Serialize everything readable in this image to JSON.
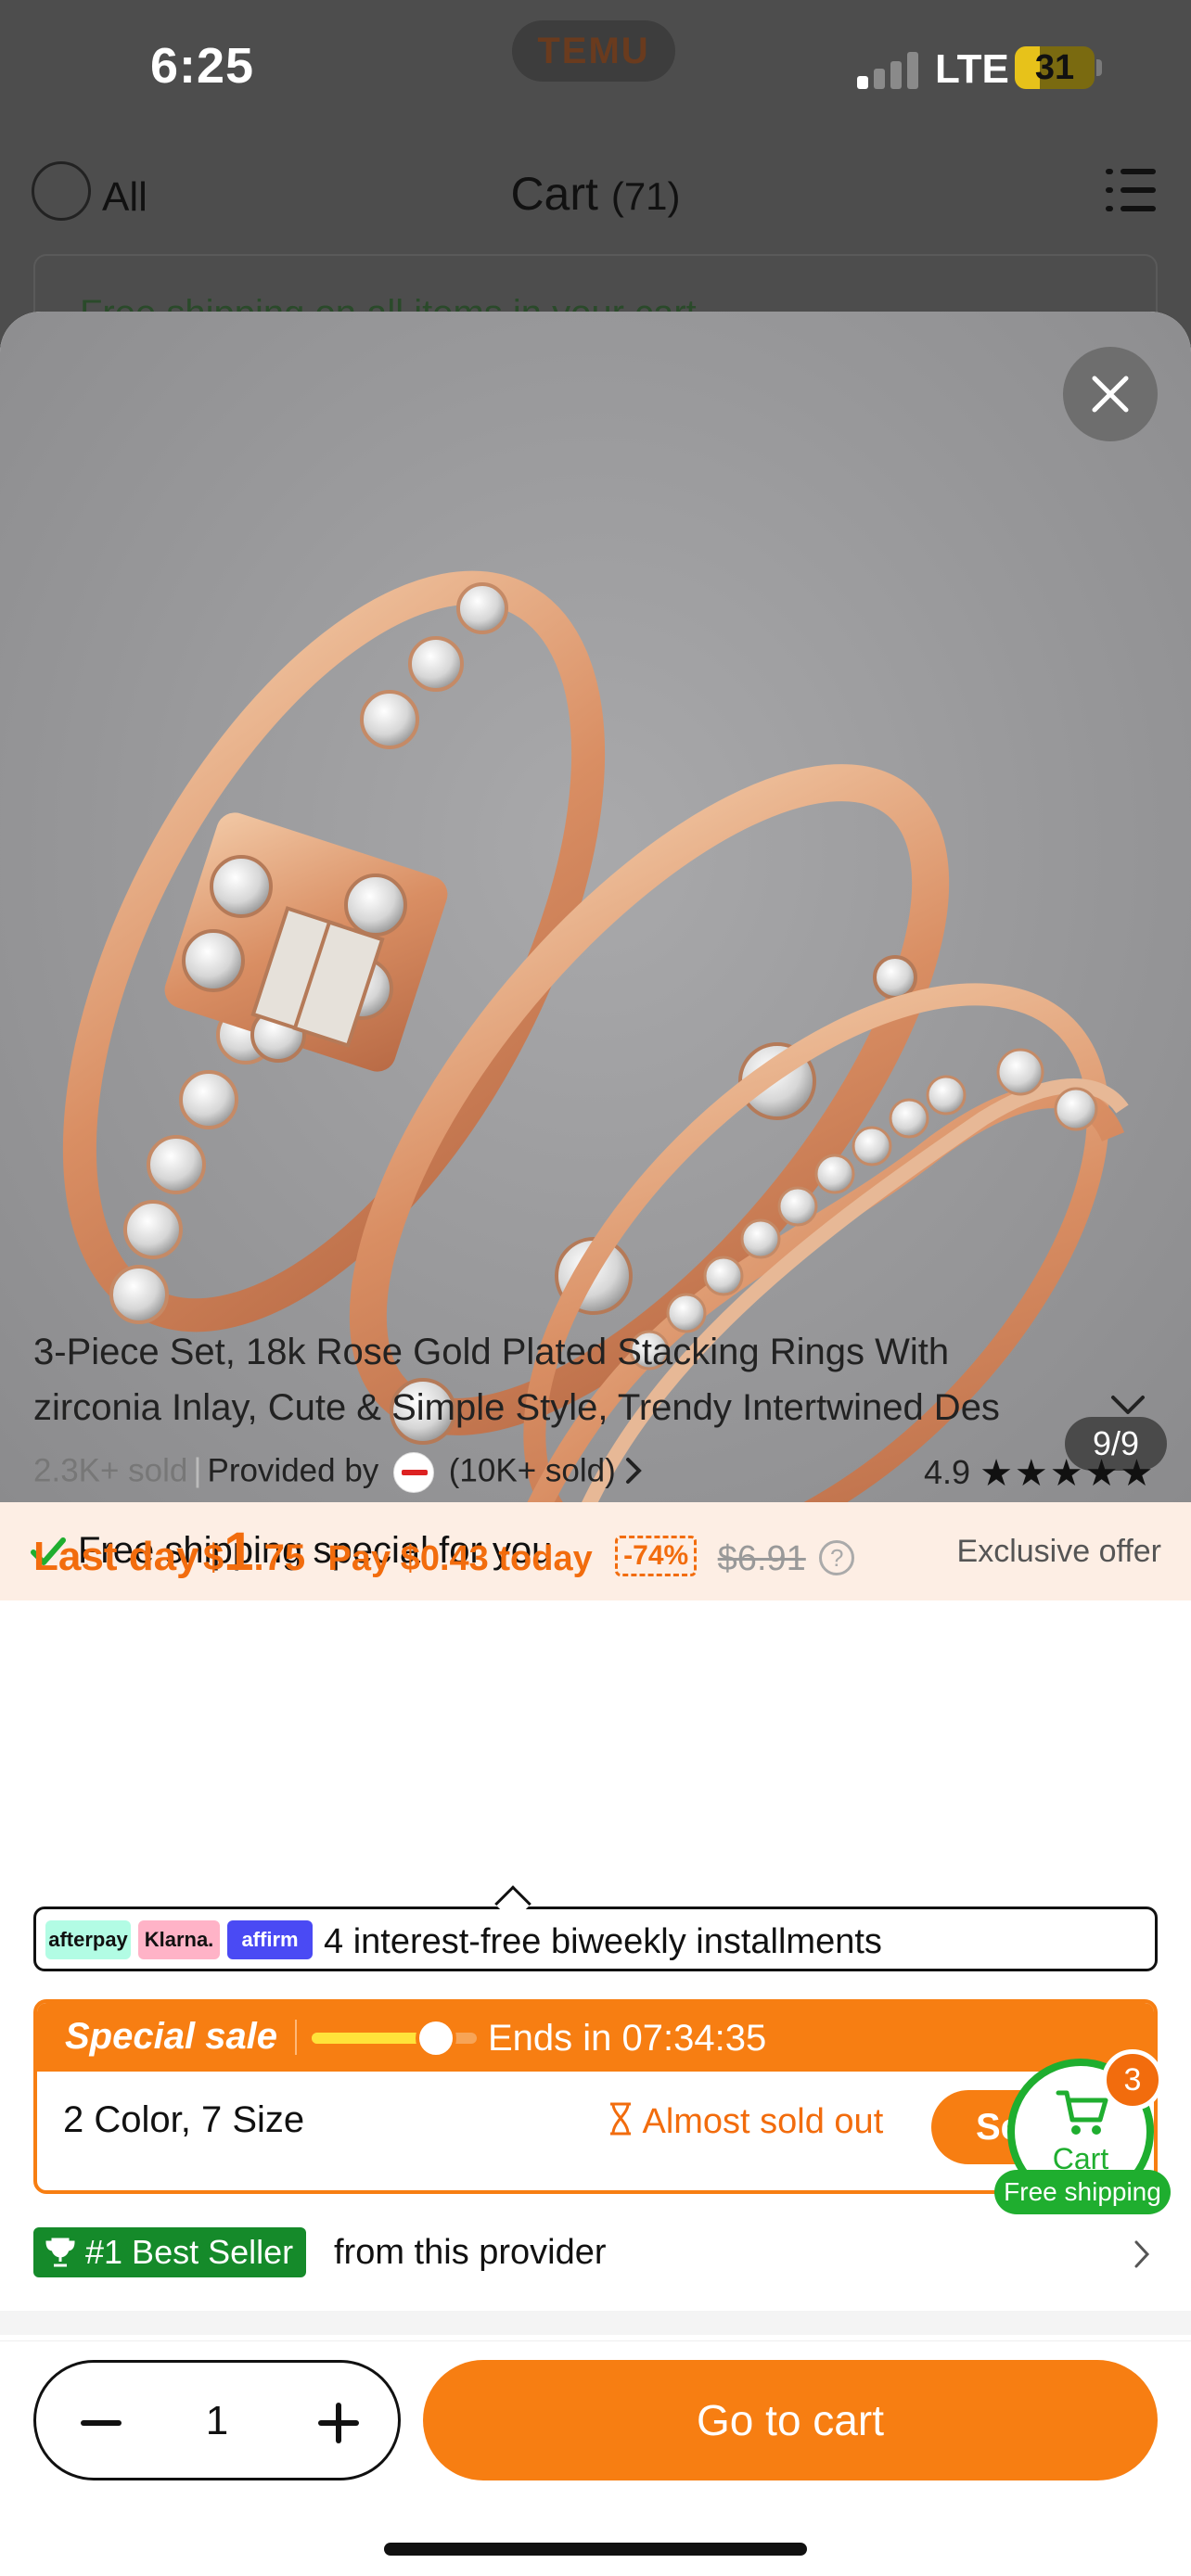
{
  "status_bar": {
    "time": "6:25",
    "brand": "TEMU",
    "network": "LTE",
    "battery": "31",
    "battery_level": 0.31
  },
  "cart_header": {
    "all_label": "All",
    "title": "Cart",
    "count": "(71)",
    "shipping_notice": "Free shipping on all items in your cart"
  },
  "gallery": {
    "counter": "9/9"
  },
  "shipping_banner": {
    "text": "Free shipping special for you",
    "offer": "Exclusive offer"
  },
  "product": {
    "title_line1": "3-Piece Set, 18k Rose Gold Plated Stacking Rings With",
    "title_line2": "zirconia Inlay, Cute & Simple Style, Trendy Intertwined Des",
    "sold": "2.3K+ sold",
    "provided_by": "Provided by",
    "provider_sold": "(10K+ sold)",
    "rating": "4.9",
    "stars": "★★★★★"
  },
  "price": {
    "label": "Last day",
    "currency": "$",
    "whole": "1",
    "cents": ".75",
    "pay_today": "Pay $0.43 today",
    "discount": "-74%",
    "original": "$6.91",
    "help": "?"
  },
  "installments": {
    "logos": [
      "afterpay",
      "Klarna.",
      "affirm"
    ],
    "text": "4 interest-free biweekly installments"
  },
  "special_sale": {
    "label": "Special sale",
    "progress": 0.72,
    "ends_label": "Ends in",
    "countdown": "07:34:35",
    "options": "2 Color, 7 Size",
    "stock": "Almost sold out",
    "select_label": "Se"
  },
  "floating_cart": {
    "label": "Cart",
    "badge": "3",
    "free": "Free shipping"
  },
  "best_seller": {
    "badge": "#1 Best Seller",
    "tail": "from this provider"
  },
  "bottom_bar": {
    "quantity": "1",
    "go_to_cart": "Go to cart"
  },
  "colors": {
    "accent": "#f77e12",
    "price": "#f26c0d",
    "green": "#1fae2f",
    "best_seller": "#158a2a"
  }
}
